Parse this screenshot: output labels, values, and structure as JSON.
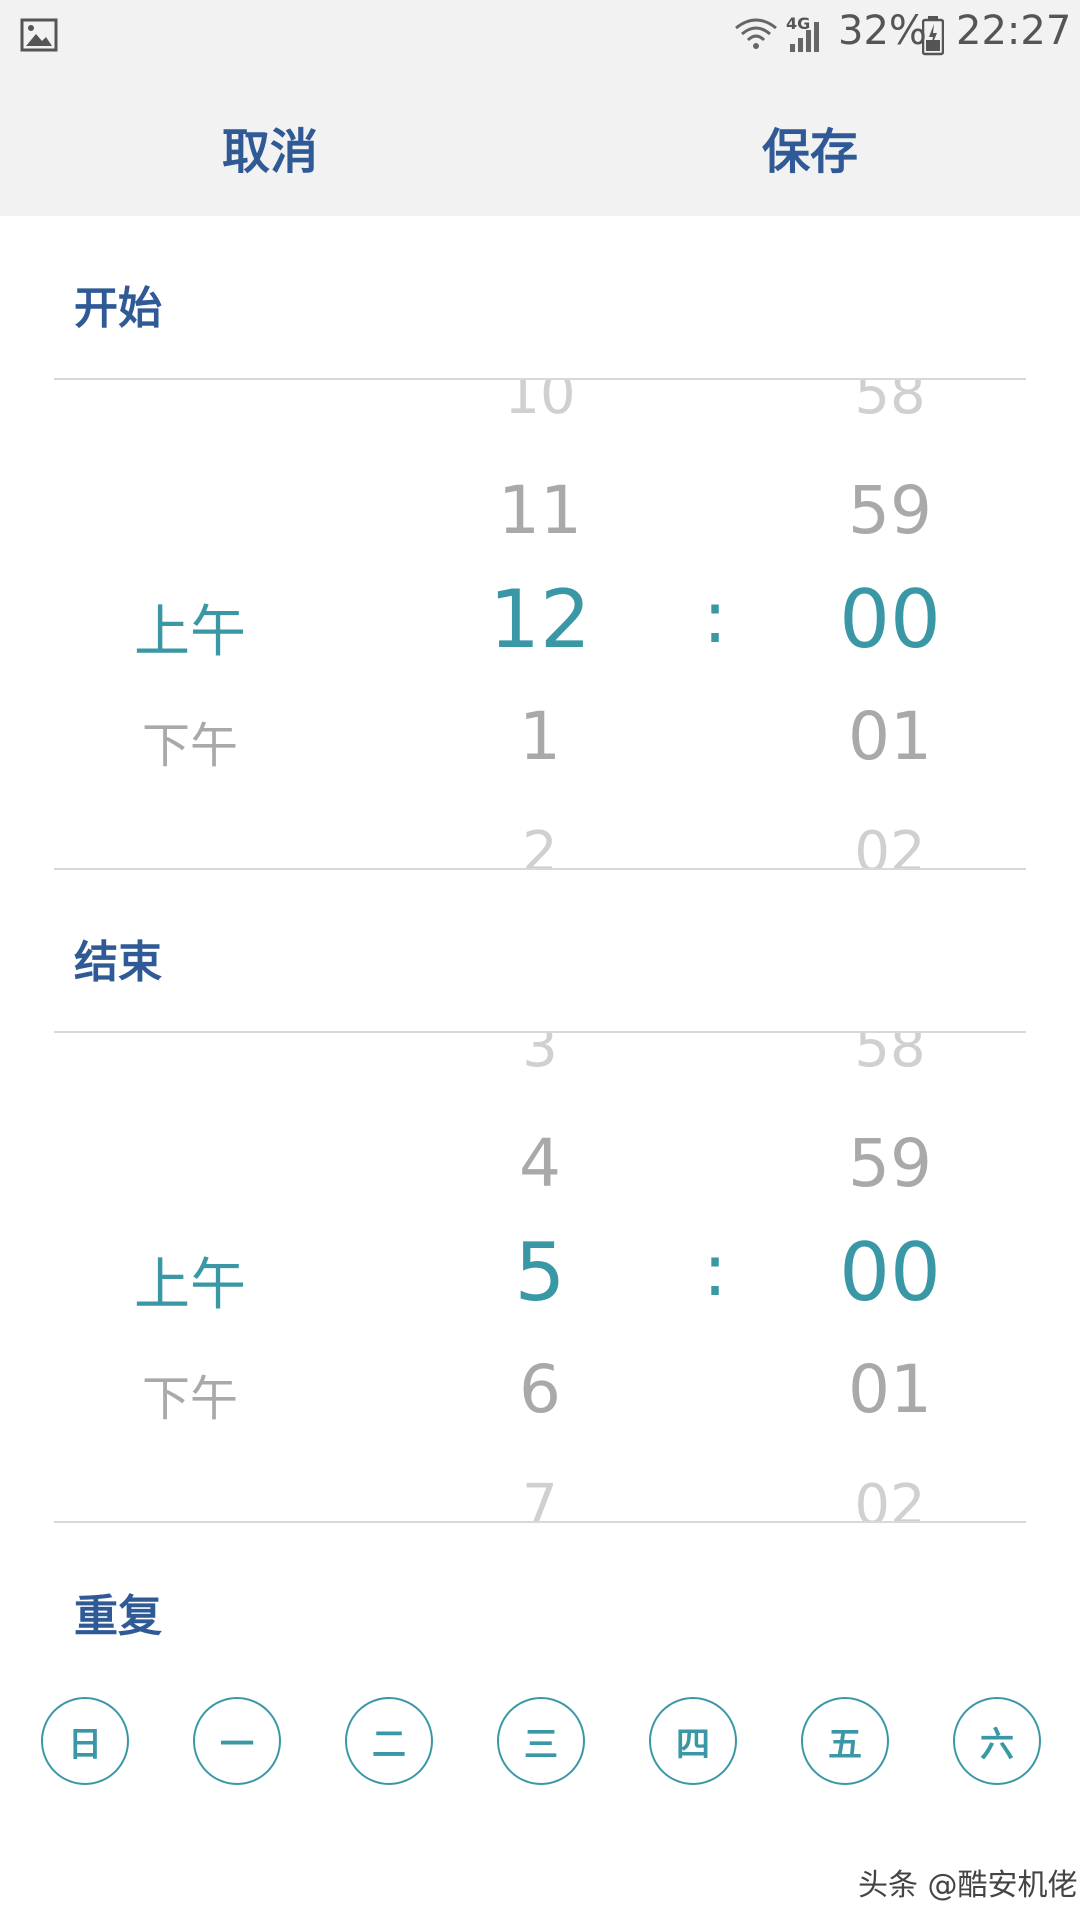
{
  "status_bar": {
    "network": "4G",
    "battery": "32%",
    "time": "22:27",
    "icons": [
      "gallery-icon",
      "wifi-icon",
      "signal-icon",
      "battery-icon"
    ]
  },
  "toolbar": {
    "cancel_label": "取消",
    "save_label": "保存"
  },
  "start": {
    "title": "开始",
    "ampm_selected": "上午",
    "ampm_next": "下午",
    "hours": [
      "10",
      "11",
      "12",
      "1",
      "2"
    ],
    "minutes": [
      "58",
      "59",
      "00",
      "01",
      "02"
    ],
    "separator": ":"
  },
  "end": {
    "title": "结束",
    "ampm_selected": "上午",
    "ampm_next": "下午",
    "hours": [
      "3",
      "4",
      "5",
      "6",
      "7"
    ],
    "minutes": [
      "58",
      "59",
      "00",
      "01",
      "02"
    ],
    "separator": ":"
  },
  "repeat": {
    "title": "重复",
    "days": [
      "日",
      "一",
      "二",
      "三",
      "四",
      "五",
      "六"
    ]
  },
  "watermark": "头条 @酷安机佬",
  "colors": {
    "accent": "#3a98a6",
    "header_text": "#2f5a96",
    "bar_bg": "#f2f2f2"
  }
}
